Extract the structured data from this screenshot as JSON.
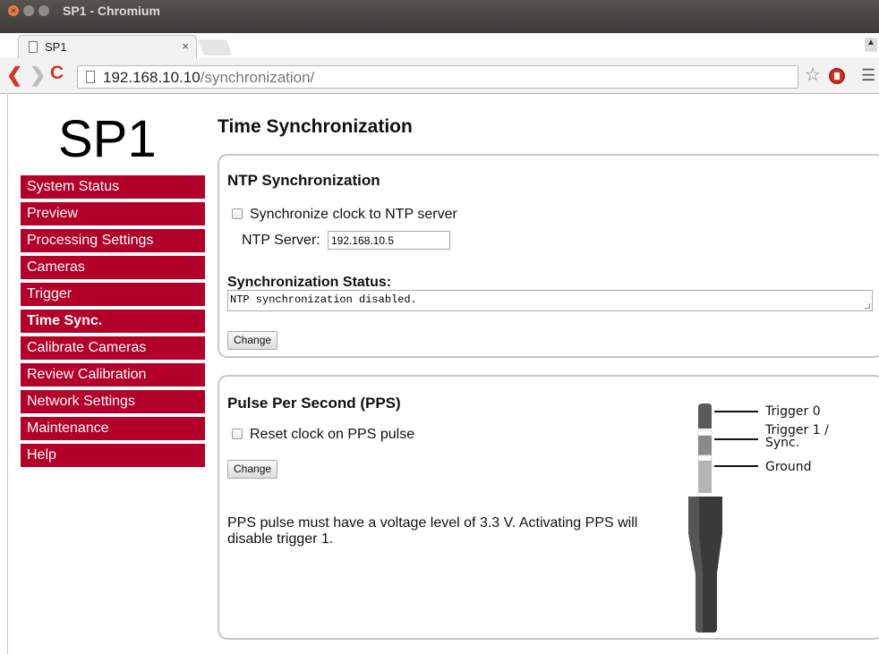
{
  "window": {
    "title": "SP1 - Chromium"
  },
  "tab": {
    "title": "SP1",
    "close": "×"
  },
  "browser": {
    "url_host": "192.168.10.10",
    "url_path": "/synchronization/"
  },
  "logo": "SP1",
  "sidebar": {
    "items": [
      {
        "label": "System Status"
      },
      {
        "label": "Preview"
      },
      {
        "label": "Processing Settings"
      },
      {
        "label": "Cameras"
      },
      {
        "label": "Trigger"
      },
      {
        "label": "Time Sync.",
        "active": true
      },
      {
        "label": "Calibrate Cameras"
      },
      {
        "label": "Review Calibration"
      },
      {
        "label": "Network Settings"
      },
      {
        "label": "Maintenance"
      },
      {
        "label": "Help"
      }
    ]
  },
  "page": {
    "title": "Time Synchronization"
  },
  "ntp": {
    "title": "NTP Synchronization",
    "sync_label": "Synchronize clock to NTP server",
    "sync_checked": false,
    "server_label": "NTP Server:",
    "server_value": "192.168.10.5",
    "status_label": "Synchronization Status:",
    "status_text": "NTP synchronization disabled.",
    "change_label": "Change"
  },
  "pps": {
    "title": "Pulse Per Second (PPS)",
    "reset_label": "Reset clock on PPS pulse",
    "reset_checked": false,
    "change_label": "Change",
    "note": "PPS pulse must have a voltage level of 3.3 V. Activating PPS will disable trigger 1.",
    "jack_labels": {
      "trigger0": "Trigger 0",
      "trigger1_line1": "Trigger 1 /",
      "trigger1_line2": "Sync.",
      "ground": "Ground"
    }
  },
  "colors": {
    "sidebar_bg": "#b3002a",
    "accent_red": "#d6342b"
  },
  "icons": {
    "back": "back-arrow-icon",
    "forward": "forward-arrow-icon",
    "reload": "reload-icon",
    "page": "page-icon",
    "star": "bookmark-star-icon",
    "extension": "stop-sign-extension-icon",
    "menu": "hamburger-menu-icon"
  }
}
